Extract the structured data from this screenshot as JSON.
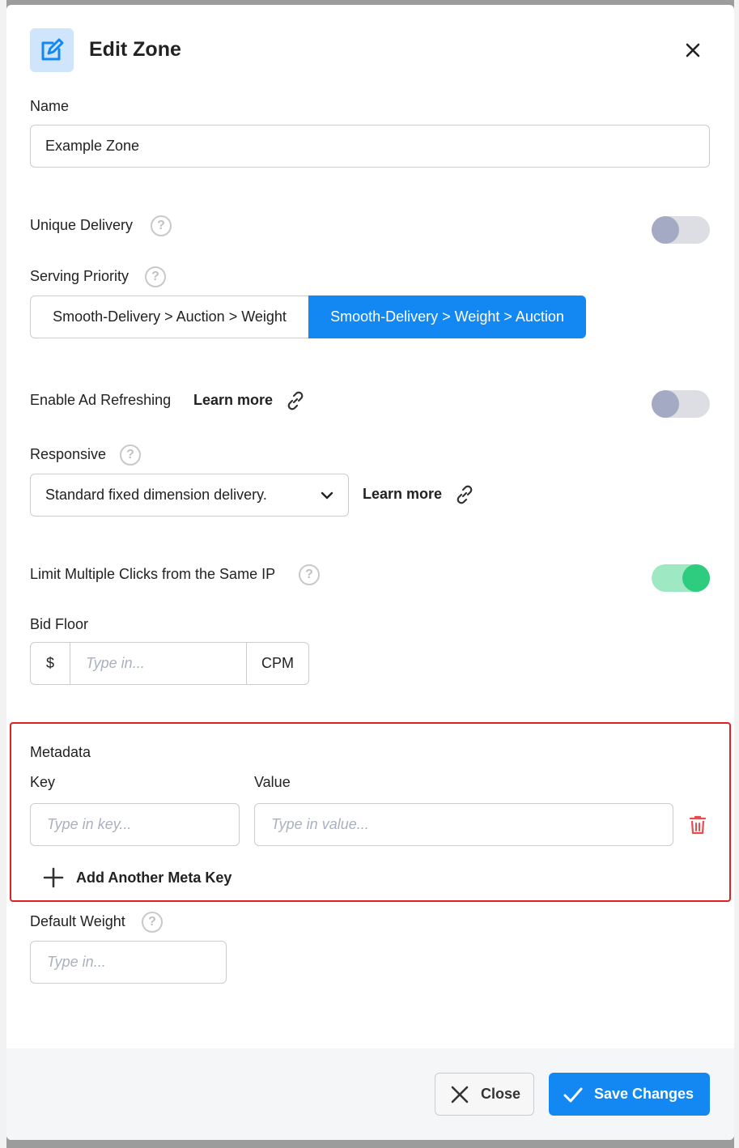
{
  "modal": {
    "title": "Edit Zone",
    "close_icon": "close-icon"
  },
  "name": {
    "label": "Name",
    "value": "Example Zone"
  },
  "unique_delivery": {
    "label": "Unique Delivery",
    "help": "?",
    "enabled": false
  },
  "serving_priority": {
    "label": "Serving Priority",
    "help": "?",
    "options": [
      "Smooth-Delivery > Auction > Weight",
      "Smooth-Delivery > Weight > Auction"
    ],
    "selected": "Smooth-Delivery > Weight > Auction"
  },
  "ad_refreshing": {
    "label": "Enable Ad Refreshing",
    "learn_more": "Learn more",
    "enabled": false
  },
  "responsive": {
    "label": "Responsive",
    "help": "?",
    "selected": "Standard fixed dimension delivery.",
    "learn_more": "Learn more"
  },
  "limit_clicks": {
    "label": "Limit Multiple Clicks from the Same IP",
    "help": "?",
    "enabled": true
  },
  "bid_floor": {
    "label": "Bid Floor",
    "prefix": "$",
    "placeholder": "Type in...",
    "suffix": "CPM"
  },
  "metadata": {
    "label": "Metadata",
    "key_label": "Key",
    "value_label": "Value",
    "key_placeholder": "Type in key...",
    "value_placeholder": "Type in value...",
    "add_label": "Add Another Meta Key"
  },
  "default_weight": {
    "label": "Default Weight",
    "help": "?",
    "placeholder": "Type in..."
  },
  "footer": {
    "close_label": "Close",
    "save_label": "Save Changes"
  },
  "colors": {
    "accent": "#1387f2",
    "toggle_on": "#2ecc7e",
    "danger": "#e02020"
  }
}
